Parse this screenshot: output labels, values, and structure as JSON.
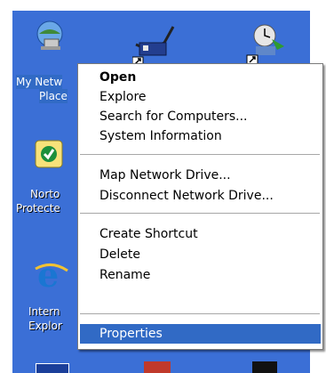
{
  "desktop_icons": {
    "network": {
      "label1": "My Netw",
      "label2": "Place",
      "icon": "network-places-icon"
    },
    "norton": {
      "label1": "Norto",
      "label2": "Protecte",
      "icon": "norton-icon"
    },
    "ie": {
      "label1": "Intern",
      "label2": "Explor",
      "icon": "internet-explorer-icon"
    },
    "shortcut1": {
      "icon": "network-cable-shortcut-icon"
    },
    "shortcut2": {
      "icon": "clock-globe-shortcut-icon"
    }
  },
  "context_menu": {
    "group1": [
      "Open",
      "Explore",
      "Search for Computers...",
      "System Information"
    ],
    "group2": [
      "Map Network Drive...",
      "Disconnect Network Drive..."
    ],
    "group3": [
      "Create Shortcut",
      "Delete",
      "Rename"
    ],
    "group4": [
      "Properties"
    ],
    "highlighted_item": "Properties",
    "default_item": "Open"
  },
  "colors": {
    "desktop": "#3b6fd6",
    "selection": "#316ac5"
  }
}
